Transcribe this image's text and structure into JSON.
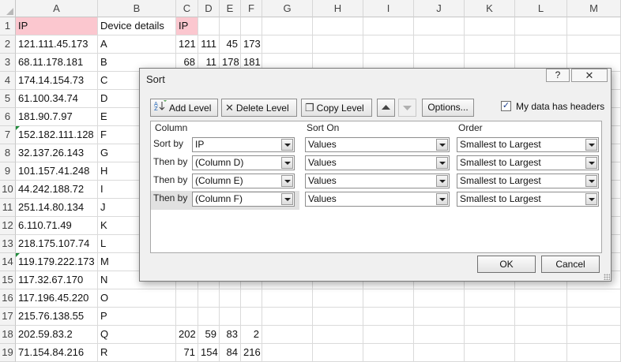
{
  "columns": [
    "A",
    "B",
    "C",
    "D",
    "E",
    "F",
    "G",
    "H",
    "I",
    "J",
    "K",
    "L",
    "M"
  ],
  "rows": [
    {
      "n": "1",
      "a": "IP",
      "b": "Device details",
      "c": "IP",
      "d": "",
      "e": "",
      "f": ""
    },
    {
      "n": "2",
      "a": "121.111.45.173",
      "b": "A",
      "c": "121",
      "d": "111",
      "e": "45",
      "f": "173"
    },
    {
      "n": "3",
      "a": "68.11.178.181",
      "b": "B",
      "c": "68",
      "d": "11",
      "e": "178",
      "f": "181"
    },
    {
      "n": "4",
      "a": "174.14.154.73",
      "b": "C",
      "c": "",
      "d": "",
      "e": "",
      "f": ""
    },
    {
      "n": "5",
      "a": "61.100.34.74",
      "b": "D",
      "c": "",
      "d": "",
      "e": "",
      "f": ""
    },
    {
      "n": "6",
      "a": "181.90.7.97",
      "b": "E",
      "c": "",
      "d": "",
      "e": "",
      "f": ""
    },
    {
      "n": "7",
      "a": "152.182.111.128",
      "b": "F",
      "c": "",
      "d": "",
      "e": "",
      "f": ""
    },
    {
      "n": "8",
      "a": "32.137.26.143",
      "b": "G",
      "c": "",
      "d": "",
      "e": "",
      "f": ""
    },
    {
      "n": "9",
      "a": "101.157.41.248",
      "b": "H",
      "c": "",
      "d": "",
      "e": "",
      "f": ""
    },
    {
      "n": "10",
      "a": "44.242.188.72",
      "b": "I",
      "c": "",
      "d": "",
      "e": "",
      "f": ""
    },
    {
      "n": "11",
      "a": "251.14.80.134",
      "b": "J",
      "c": "",
      "d": "",
      "e": "",
      "f": ""
    },
    {
      "n": "12",
      "a": "6.110.71.49",
      "b": "K",
      "c": "",
      "d": "",
      "e": "",
      "f": ""
    },
    {
      "n": "13",
      "a": "218.175.107.74",
      "b": "L",
      "c": "",
      "d": "",
      "e": "",
      "f": ""
    },
    {
      "n": "14",
      "a": "119.179.222.173",
      "b": "M",
      "c": "",
      "d": "",
      "e": "",
      "f": ""
    },
    {
      "n": "15",
      "a": "117.32.67.170",
      "b": "N",
      "c": "",
      "d": "",
      "e": "",
      "f": ""
    },
    {
      "n": "16",
      "a": "117.196.45.220",
      "b": "O",
      "c": "",
      "d": "",
      "e": "",
      "f": ""
    },
    {
      "n": "17",
      "a": "215.76.138.55",
      "b": "P",
      "c": "",
      "d": "",
      "e": "",
      "f": ""
    },
    {
      "n": "18",
      "a": "202.59.83.2",
      "b": "Q",
      "c": "202",
      "d": "59",
      "e": "83",
      "f": "2"
    },
    {
      "n": "19",
      "a": "71.154.84.216",
      "b": "R",
      "c": "71",
      "d": "154",
      "e": "84",
      "f": "216"
    }
  ],
  "dialog": {
    "title": "Sort",
    "help": "?",
    "close": "✕",
    "add_level": "Add Level",
    "delete_level": "Delete Level",
    "copy_level": "Copy Level",
    "options": "Options...",
    "headers_checkbox": "My data has headers",
    "headers_checked": true,
    "col_header": "Column",
    "sorton_header": "Sort On",
    "order_header": "Order",
    "levels": [
      {
        "label": "Sort by",
        "column": "IP",
        "sort_on": "Values",
        "order": "Smallest to Largest"
      },
      {
        "label": "Then by",
        "column": "(Column D)",
        "sort_on": "Values",
        "order": "Smallest to Largest"
      },
      {
        "label": "Then by",
        "column": "(Column E)",
        "sort_on": "Values",
        "order": "Smallest to Largest"
      },
      {
        "label": "Then by",
        "column": "(Column F)",
        "sort_on": "Values",
        "order": "Smallest to Largest"
      }
    ],
    "ok": "OK",
    "cancel": "Cancel"
  },
  "colors": {
    "header_highlight": "#fbc7cf",
    "error_triangle": "#1e8a3a",
    "dialog_bg": "#f0f0f0"
  }
}
